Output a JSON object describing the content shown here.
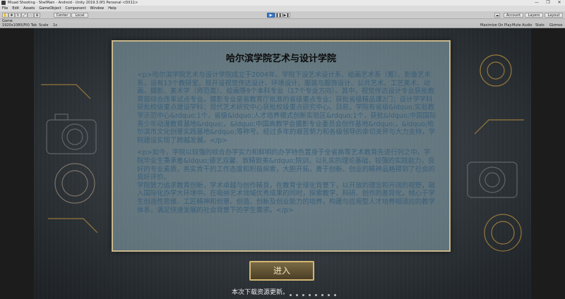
{
  "window": {
    "title": "Miuad Shooting - ShelMain - Android - Unity 2019.3.0f1 Personal <DX11>",
    "controls": [
      "—",
      "❐",
      "✕"
    ]
  },
  "menu": [
    "File",
    "Edit",
    "Assets",
    "GameObject",
    "Component",
    "Window",
    "Help"
  ],
  "toolbar": {
    "pivot": "Center",
    "space": "Local",
    "account": "Account",
    "layers": "Layers",
    "layout": "Layout"
  },
  "game_tab": {
    "label": "Game"
  },
  "game_bar": {
    "display": "1920x1080(Fill) Tab",
    "aspect": "Scale",
    "scale_value": "1x",
    "maximize": "Maximize On Play",
    "mute": "Mute Audio",
    "stats": "Stats",
    "gizmos": "Gizmos"
  },
  "panel": {
    "title": "哈尔滨学院艺术与设计学院",
    "paragraph1": "<p>哈尔滨学院艺术与设计学院成立于2004年。学院下设艺术设计系、绘画艺术系（筹）、影像艺术系，设有13个教研室。现开设视觉传达设计、环境设计、服装与服饰设计、公共艺术、工艺美术、动画、摄影、美术学（师范类）、绘画等9个本科专业（17个专业方向）。其中，视觉传达设计专业获批教育部综合改革试点专业。摄影专业是省教育厅批准的省级重点专业；获批省级精品课2门；设计学学科获批校级重点建设学科；现代艺术研究中心获批校级重点研究中心。目前，学院有省级&ldquo;实验教学示范中心&rdquo;1个，省级&ldquo;人才培养模式创新实验区&rdquo;1个，获批&ldquo;中国国际青少年动漫教育基地&rdquo;，&ldquo;中国高教学会摄影专业委员会创作基地&rdquo;，&ldquo;哈尔滨市文化创意实践基地&rdquo;等称号。经过多年的艰苦努力和各级领导的亲切关怀与大力支持，学院建设实现了跨越发展。</p>",
    "paragraph2": "<p>如今，学院以较强的综合办学实力和鲜明的办学特色置身于全省高等艺术教育先进行列之中。学院毕业生秉承着&ldquo;德艺双馨、致精致美&rdquo;院训，以扎实的理论基础，较强的实践能力，良好的专业素质，务实肯干的工作态度和积极探索，大胆开拓，勇于创新、创业的精神品格得到了社会的良好评价。",
    "paragraph3": "学院致力追求教育创新，学术卓越与创作精良，在教育全球化背景下，以开放的理念和开阔的视野，融入国际化办学大环境中。在吸纳艺术领域优秀成果的同时，探索教学、科研、创作的差异化，倾心于学生创造性思维、工匠精神和创意、创造、创新及创业能力的培养，构建与应用型人才培养相适应的教学体系，满足快速发展的社会背景下的学生需求。</p>"
  },
  "enter_button": {
    "label": "进入"
  },
  "status_text": "本次下载资源更新。",
  "colors": {
    "panel_text": "#3a5f7a",
    "accent_gold": "#d2b673",
    "play_active": "#3b78c3"
  }
}
